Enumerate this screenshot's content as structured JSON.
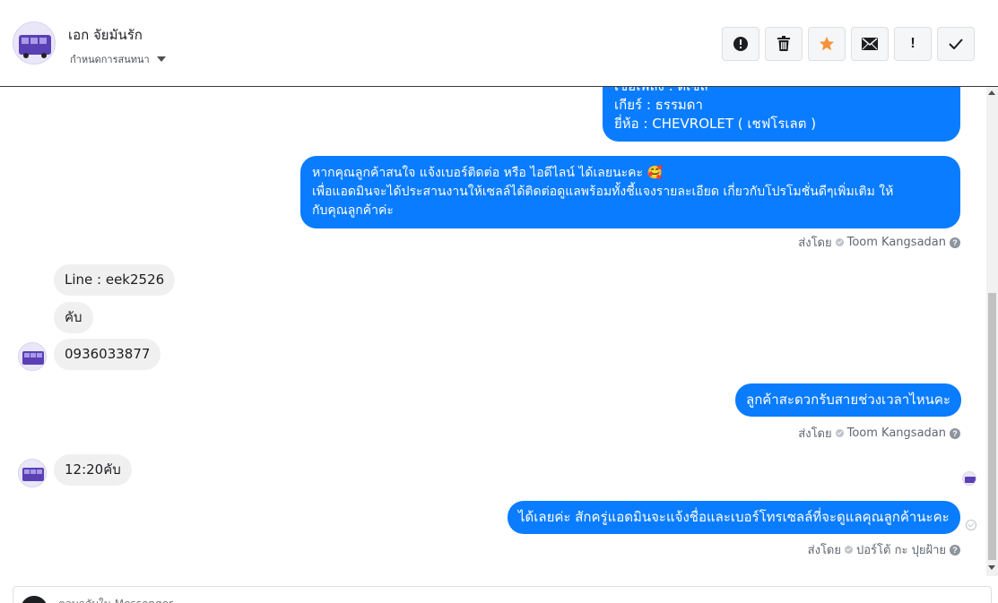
{
  "header": {
    "contact_name": "เอก จัยมันรัก",
    "assign_label": "กำหนดการสนทนา",
    "avatar_icon": "bus-photo-avatar",
    "toolbar": [
      {
        "name": "mark-spam-button",
        "icon": "exclamation-circle-icon"
      },
      {
        "name": "delete-button",
        "icon": "trash-icon"
      },
      {
        "name": "star-button",
        "icon": "star-icon",
        "color": "#f7923b"
      },
      {
        "name": "mark-unread-button",
        "icon": "envelope-icon"
      },
      {
        "name": "follow-up-button",
        "icon": "exclamation-icon",
        "glyph": "!"
      },
      {
        "name": "mark-done-button",
        "icon": "checkmark-icon"
      }
    ]
  },
  "thread": {
    "msg1": {
      "lines": [
        "เชื้อเพลิง : ดีเซล",
        "เกียร์ : ธรรมดา",
        "ยี่ห้อ : CHEVROLET ( เชฟโรเลต )"
      ]
    },
    "msg2": {
      "lines": [
        "หากคุณลูกค้าสนใจ แจ้งเบอร์ติดต่อ หรือ ไอดีไลน์ ได้เลยนะคะ 🥰",
        "เพื่อแอดมินจะได้ประสานงานให้เซลล์ได้ติดต่อดูแลพร้อมทั้งชี้แจงรายละเอียด เกี่ยวกับโปรโมชั่นดีๆเพิ่มเติม ให้",
        "กับคุณลูกค้าค่ะ"
      ],
      "sent_by": "ส่งโดย",
      "sender": "Toom Kangsadan"
    },
    "in1": "Line : eek2526",
    "in2": "คับ",
    "in3": "0936033877",
    "msg3": {
      "text": "ลูกค้าสะดวกรับสายช่วงเวลาไหนคะ",
      "sent_by": "ส่งโดย",
      "sender": "Toom Kangsadan"
    },
    "in4": "12:20คับ",
    "msg4": {
      "text": "ได้เลยค่ะ สักครู่แอดมินจะแจ้งชื่อและเบอร์โทรเซลล์ที่จะดูแลคุณลูกค้านะคะ",
      "sent_by": "ส่งโดย",
      "sender": "ปอร์โต้ กะ ปุยฝ้าย"
    }
  },
  "composer": {
    "placeholder": "ตอบกลับใน Messenger..."
  },
  "colors": {
    "outgoing_bubble": "#0a7cff",
    "incoming_bubble": "#f1f0f0",
    "star": "#f7923b"
  }
}
